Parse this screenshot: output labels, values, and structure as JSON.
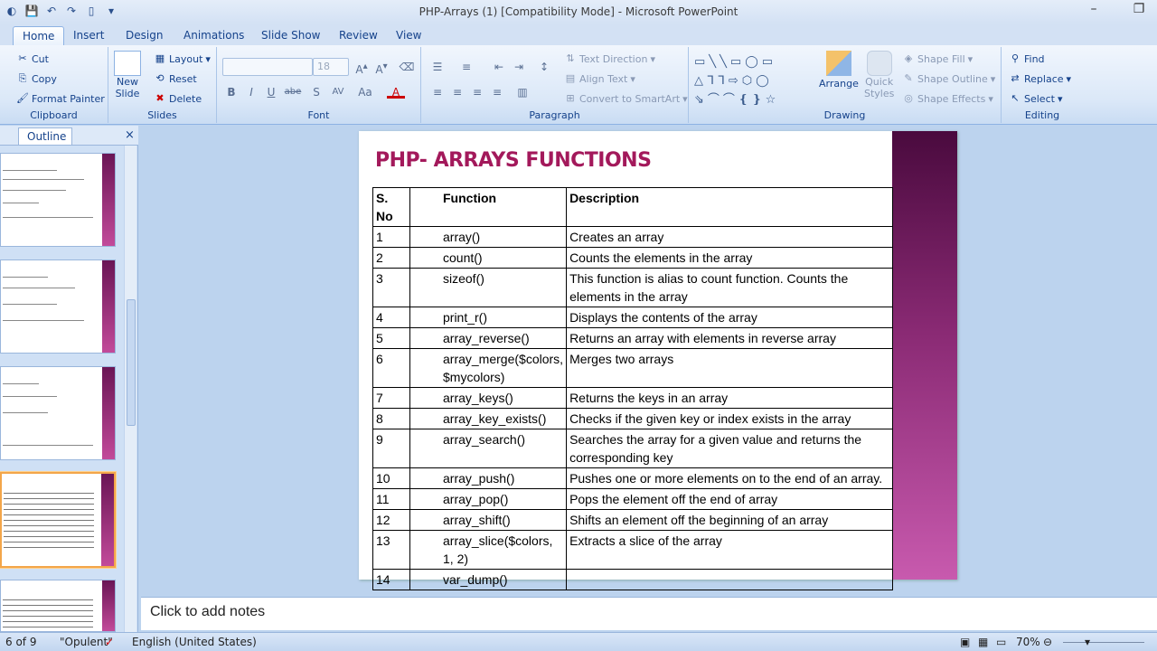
{
  "window": {
    "title": "PHP-Arrays (1) [Compatibility Mode] - Microsoft PowerPoint"
  },
  "tabs": [
    "Home",
    "Insert",
    "Design",
    "Animations",
    "Slide Show",
    "Review",
    "View"
  ],
  "ribbon": {
    "clipboard": {
      "label": "Clipboard",
      "cut": "Cut",
      "copy": "Copy",
      "format_painter": "Format Painter"
    },
    "slides": {
      "label": "Slides",
      "new_slide": "New",
      "new_slide2": "Slide",
      "layout": "Layout",
      "reset": "Reset",
      "delete": "Delete"
    },
    "font": {
      "label": "Font",
      "size": "18",
      "bold": "B",
      "italic": "I",
      "underline": "U",
      "strike": "abe",
      "shadow": "S",
      "spacing": "AV",
      "case": "Aa",
      "color": "A"
    },
    "paragraph": {
      "label": "Paragraph",
      "text_direction": "Text Direction",
      "align_text": "Align Text",
      "convert": "Convert to SmartArt"
    },
    "drawing": {
      "label": "Drawing",
      "arrange": "Arrange",
      "quick_styles": "Quick",
      "quick_styles2": "Styles",
      "shape_fill": "Shape Fill",
      "shape_outline": "Shape Outline",
      "shape_effects": "Shape Effects"
    },
    "editing": {
      "label": "Editing",
      "find": "Find",
      "replace": "Replace",
      "select": "Select"
    }
  },
  "panel": {
    "outline_tab": "Outline",
    "close": "×"
  },
  "slide": {
    "title": "PHP- ARRAYS FUNCTIONS",
    "headers": {
      "sno": "S. No",
      "function": "Function",
      "description": "Description"
    },
    "rows": [
      {
        "no": "1",
        "fn": "array()",
        "desc": "Creates an array"
      },
      {
        "no": "2",
        "fn": "count()",
        "desc": "Counts the elements in the array"
      },
      {
        "no": "3",
        "fn": "sizeof()",
        "desc": "This function is alias to count function. Counts the elements in the array"
      },
      {
        "no": "4",
        "fn": "print_r()",
        "desc": "Displays the contents of the array"
      },
      {
        "no": "5",
        "fn": "array_reverse()",
        "desc": "Returns an array with elements in reverse array"
      },
      {
        "no": "6",
        "fn": "array_merge($colors, $mycolors)",
        "desc": "Merges two arrays"
      },
      {
        "no": "7",
        "fn": "array_keys()",
        "desc": "Returns the keys in an array"
      },
      {
        "no": "8",
        "fn": "array_key_exists()",
        "desc": "Checks if the given key or index exists in the array"
      },
      {
        "no": "9",
        "fn": "array_search()",
        "desc": "Searches the array for a given value and returns the corresponding key"
      },
      {
        "no": "10",
        "fn": "array_push()",
        "desc": "Pushes one or more elements on to the end of an array."
      },
      {
        "no": "11",
        "fn": "array_pop()",
        "desc": "Pops the element off the end of array"
      },
      {
        "no": "12",
        "fn": "array_shift()",
        "desc": "Shifts an element off the beginning of an array"
      },
      {
        "no": "13",
        "fn": "array_slice($colors, 1, 2)",
        "desc": "Extracts a slice of the array"
      },
      {
        "no": "14",
        "fn": "var_dump()",
        "desc": ""
      }
    ]
  },
  "notes": {
    "placeholder": "Click to add notes"
  },
  "status": {
    "slide": "6 of 9",
    "theme": "\"Opulent\"",
    "language": "English (United States)",
    "zoom": "70%"
  }
}
